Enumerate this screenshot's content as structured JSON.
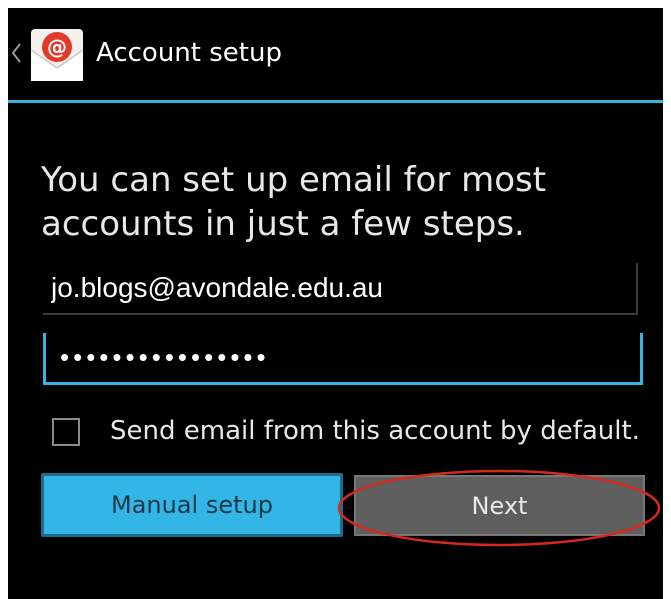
{
  "action_bar": {
    "title": "Account setup"
  },
  "instructions": "You can set up email for most\naccounts in just a few steps.",
  "email_field": {
    "value": "jo.blogs@avondale.edu.au"
  },
  "password_field": {
    "value": "••••••••••••••••"
  },
  "default_option": {
    "label": "Send email from this account by default.",
    "checked": false
  },
  "buttons": {
    "manual_setup": "Manual setup",
    "next": "Next"
  },
  "icons": {
    "back": "chevron-left-icon",
    "app": "email-app-icon"
  },
  "colors": {
    "accent": "#33b5e5",
    "annotation": "#d42a1e",
    "background": "#000000"
  }
}
